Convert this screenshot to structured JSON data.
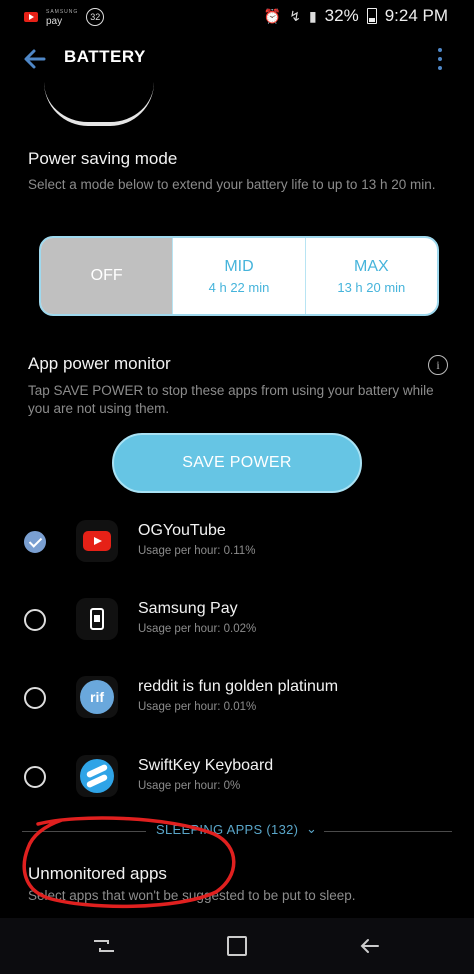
{
  "status_bar": {
    "pay_label": "pay",
    "pay_brand": "SAMSUNG",
    "notif_count": "32",
    "battery_percent": "32%",
    "time": "9:24 PM",
    "icons": [
      "youtube-icon",
      "samsung-pay-icon",
      "alarm-icon",
      "data-saver-icon",
      "lte-icon",
      "signal-icon",
      "battery-icon"
    ]
  },
  "app_bar": {
    "title": "BATTERY"
  },
  "power_saving": {
    "title": "Power saving mode",
    "description": "Select a mode below to extend your battery life to up to 13 h 20 min.",
    "modes": [
      {
        "name": "OFF",
        "time": ""
      },
      {
        "name": "MID",
        "time": "4 h 22 min"
      },
      {
        "name": "MAX",
        "time": "13 h 20 min"
      }
    ],
    "selected": "OFF"
  },
  "app_power_monitor": {
    "title": "App power monitor",
    "description": "Tap SAVE POWER to stop these apps from using your battery while you are not using them.",
    "save_button": "SAVE POWER",
    "apps": [
      {
        "name": "OGYouTube",
        "usage": "Usage per hour: 0.11%",
        "checked": true,
        "icon": "youtube-icon"
      },
      {
        "name": "Samsung Pay",
        "usage": "Usage per hour: 0.02%",
        "checked": false,
        "icon": "samsung-pay-icon"
      },
      {
        "name": "reddit is fun golden platinum",
        "usage": "Usage per hour: 0.01%",
        "checked": false,
        "icon": "rif-icon"
      },
      {
        "name": "SwiftKey Keyboard",
        "usage": "Usage per hour: 0%",
        "checked": false,
        "icon": "swiftkey-icon"
      }
    ],
    "rif_icon_text": "rif",
    "sleeping_apps": "SLEEPING APPS (132)"
  },
  "unmonitored": {
    "title": "Unmonitored apps",
    "description": "Select apps that won't be suggested to be put to sleep."
  },
  "colors": {
    "accent": "#46b4db",
    "save_button": "#66c5e4",
    "annotation": "#e0201f",
    "check": "#7a9fd1"
  }
}
